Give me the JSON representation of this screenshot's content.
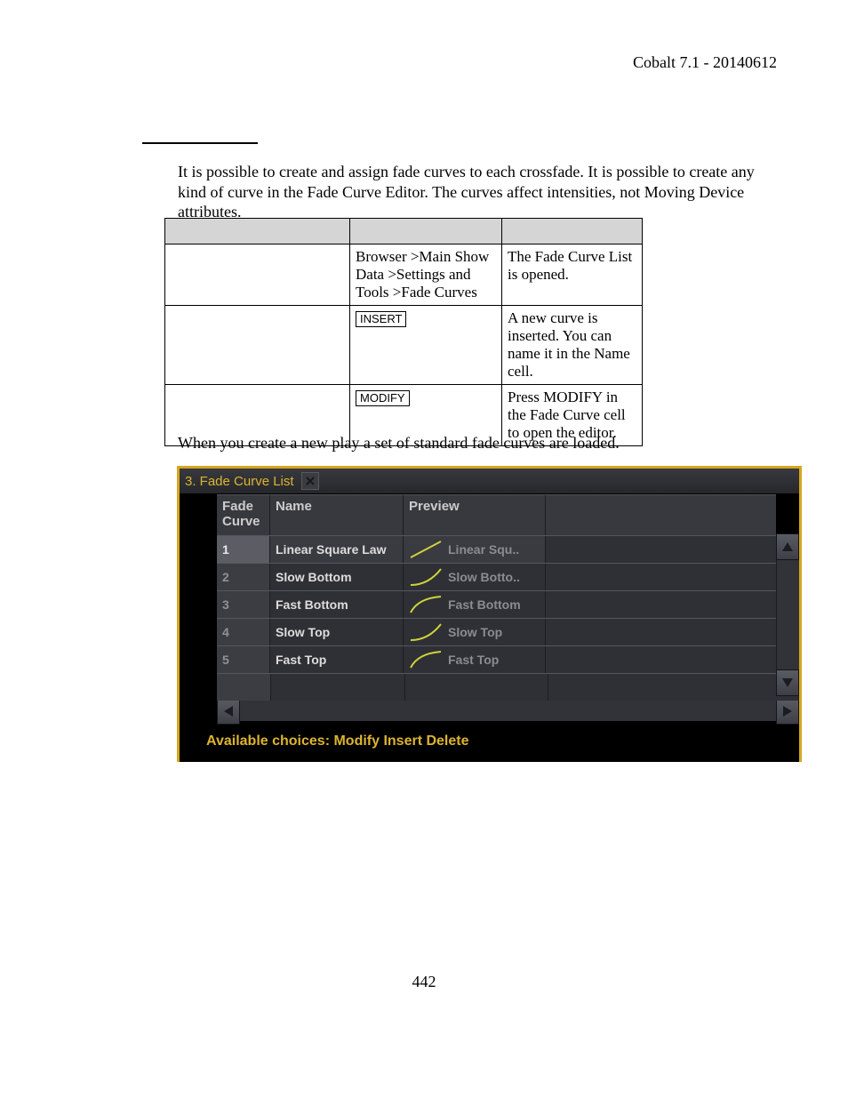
{
  "header": "Cobalt 7.1 - 20140612",
  "intro": "It is possible to create and assign fade curves to each crossfade. It is possible to create any kind of curve in the Fade Curve Editor. The curves affect intensities, not Moving Device attributes.",
  "deftable": {
    "rows": [
      {
        "key": "Browser >Main Show Data >Settings and Tools >Fade Curves",
        "keytype": "text",
        "desc": "The Fade Curve List is opened."
      },
      {
        "key": "INSERT",
        "keytype": "cap",
        "desc": "A new curve is inserted. You can name it in the Name cell."
      },
      {
        "key": "MODIFY",
        "keytype": "cap",
        "desc": "Press MODIFY in the Fade Curve cell to open the editor."
      }
    ]
  },
  "note": "When you create a new play  a set of standard fade curves are loaded.",
  "app": {
    "title": "3. Fade Curve List",
    "cols": {
      "a": "Fade Curve",
      "b": "Name",
      "c": "Preview"
    },
    "rows": [
      {
        "n": "1",
        "name": "Linear Square Law",
        "preview": "Linear Squ.."
      },
      {
        "n": "2",
        "name": "Slow Bottom",
        "preview": "Slow Botto.."
      },
      {
        "n": "3",
        "name": "Fast Bottom",
        "preview": "Fast Bottom"
      },
      {
        "n": "4",
        "name": "Slow Top",
        "preview": "Slow Top"
      },
      {
        "n": "5",
        "name": "Fast Top",
        "preview": "Fast Top"
      }
    ],
    "footer": "Available choices: Modify Insert Delete"
  },
  "page_number": "442"
}
